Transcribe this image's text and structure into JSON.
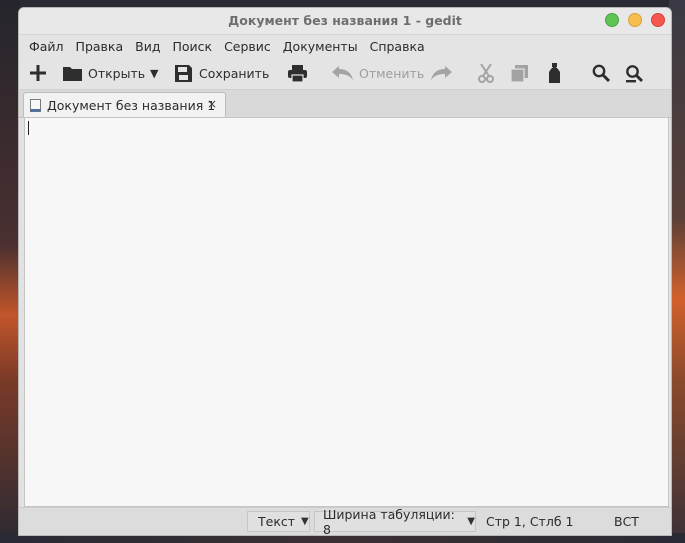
{
  "window": {
    "title": "Документ без названия 1 - gedit"
  },
  "menu": [
    "Файл",
    "Правка",
    "Вид",
    "Поиск",
    "Сервис",
    "Документы",
    "Справка"
  ],
  "toolbar": {
    "open_label": "Открыть",
    "save_label": "Сохранить",
    "undo_label": "Отменить"
  },
  "tab": {
    "label": "Документ без названия 1",
    "close": "×"
  },
  "statusbar": {
    "language": "Текст",
    "tab_width": "Ширина табуляции:  8",
    "position": "Стр 1, Стлб 1",
    "mode": "ВСТ",
    "dropdown_arrow": "▼"
  },
  "colors": {
    "close": "#f5574c",
    "minimize": "#5fc454",
    "maximize": "#f6be4f"
  }
}
